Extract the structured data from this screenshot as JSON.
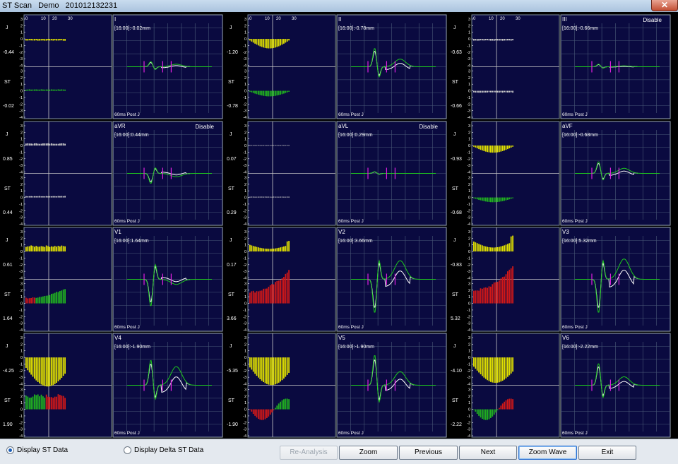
{
  "window": {
    "title": "ST Scan   Demo   201012132231",
    "close_glyph": "✕"
  },
  "trend_axis": {
    "x_ticks": [
      "0",
      "10",
      "20",
      "30"
    ],
    "y_ticks": [
      "3",
      "2",
      "1",
      "0",
      "-1",
      "-2",
      "-3",
      "-4"
    ],
    "j_label": "J",
    "st_label": "ST"
  },
  "waveform_footer": "60ms Post J",
  "leads": [
    {
      "lead": "I",
      "reading": "[16:00]:-0.02mm",
      "disable": "",
      "j_value": "-0.44",
      "st_value": "-0.02"
    },
    {
      "lead": "II",
      "reading": "[16:00]:-0.78mm",
      "disable": "",
      "j_value": "-1.20",
      "st_value": "-0.78"
    },
    {
      "lead": "III",
      "reading": "[16:00]:-0.66mm",
      "disable": "Disable",
      "j_value": "-0.63",
      "st_value": "-0.66"
    },
    {
      "lead": "aVR",
      "reading": "[16:00]:0.44mm",
      "disable": "Disable",
      "j_value": "0.85",
      "st_value": "0.44"
    },
    {
      "lead": "aVL",
      "reading": "[16:00]:0.29mm",
      "disable": "Disable",
      "j_value": "0.07",
      "st_value": "0.29"
    },
    {
      "lead": "aVF",
      "reading": "[16:00]:-0.68mm",
      "disable": "",
      "j_value": "-0.93",
      "st_value": "-0.68"
    },
    {
      "lead": "V1",
      "reading": "[16:00]:1.64mm",
      "disable": "",
      "j_value": "0.61",
      "st_value": "1.64"
    },
    {
      "lead": "V2",
      "reading": "[16:00]:3.66mm",
      "disable": "",
      "j_value": "0.17",
      "st_value": "3.66"
    },
    {
      "lead": "V3",
      "reading": "[16:00]:5.32mm",
      "disable": "",
      "j_value": "-0.83",
      "st_value": "5.32"
    },
    {
      "lead": "V4",
      "reading": "[16:00]:-1.90mm",
      "disable": "",
      "j_value": "-4.25",
      "st_value": "1.90"
    },
    {
      "lead": "V5",
      "reading": "[16:00]:-1.90mm",
      "disable": "",
      "j_value": "-5.35",
      "st_value": "-1.90"
    },
    {
      "lead": "V6",
      "reading": "[16:00]:-2.22mm",
      "disable": "",
      "j_value": "-4.10",
      "st_value": "-2.22"
    }
  ],
  "controls": {
    "display_st": "Display ST Data",
    "display_delta_st": "Display Delta ST Data",
    "selected": "display_st",
    "buttons": {
      "re_analysis": "Re-Analysis",
      "zoom": "Zoom",
      "previous": "Previous",
      "next": "Next",
      "zoom_wave": "Zoom Wave",
      "exit": "Exit"
    }
  },
  "colors": {
    "panel_bg": "#0a0a40",
    "grid": "#4a5a78",
    "j_bars": "#e0e000",
    "st_bars": "#20b020",
    "elevated_bars": "#d01818",
    "trace_green": "#1ec81e",
    "trace_white": "#ffffff",
    "marker": "#e020e0"
  }
}
